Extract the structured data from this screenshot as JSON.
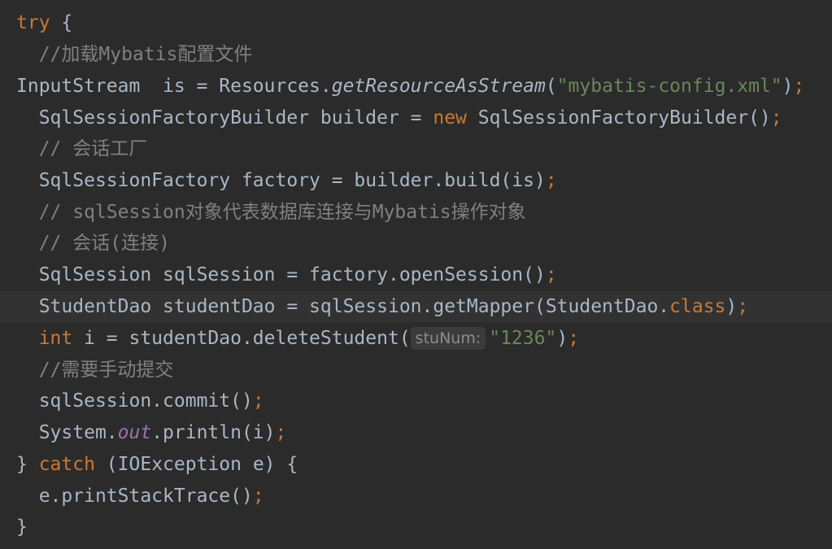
{
  "editor": {
    "lines": [
      {
        "indent": "",
        "tokens": [
          {
            "t": "try",
            "c": "kw"
          },
          {
            "t": " {",
            "c": ""
          }
        ]
      },
      {
        "indent": "  ",
        "tokens": [
          {
            "t": "//加载Mybatis配置文件",
            "c": "cmt"
          }
        ]
      },
      {
        "indent": "",
        "tokens": [
          {
            "t": "InputStream  is = Resources.",
            "c": ""
          },
          {
            "t": "getResourceAsStream",
            "c": "italic"
          },
          {
            "t": "(",
            "c": ""
          },
          {
            "t": "\"mybatis-config.xml\"",
            "c": "str"
          },
          {
            "t": ")",
            "c": ""
          },
          {
            "t": ";",
            "c": "punc"
          }
        ]
      },
      {
        "indent": "  ",
        "tokens": [
          {
            "t": "SqlSessionFactoryBuilder builder = ",
            "c": ""
          },
          {
            "t": "new",
            "c": "kw"
          },
          {
            "t": " SqlSessionFactoryBuilder()",
            "c": ""
          },
          {
            "t": ";",
            "c": "punc"
          }
        ]
      },
      {
        "indent": "  ",
        "tokens": [
          {
            "t": "// 会话工厂",
            "c": "cmt"
          }
        ]
      },
      {
        "indent": "  ",
        "tokens": [
          {
            "t": "SqlSessionFactory factory = builder.build(is)",
            "c": ""
          },
          {
            "t": ";",
            "c": "punc"
          }
        ]
      },
      {
        "indent": "  ",
        "tokens": [
          {
            "t": "// sqlSession对象代表数据库连接与Mybatis操作对象",
            "c": "cmt"
          }
        ]
      },
      {
        "indent": "  ",
        "tokens": [
          {
            "t": "// 会话(连接)",
            "c": "cmt"
          }
        ]
      },
      {
        "indent": "  ",
        "tokens": [
          {
            "t": "SqlSession sqlSession = factory.openSession()",
            "c": ""
          },
          {
            "t": ";",
            "c": "punc"
          }
        ]
      },
      {
        "indent": "  ",
        "current": true,
        "tokens": [
          {
            "t": "StudentDao studentDao = sqlSession.getMapper(StudentDao.",
            "c": ""
          },
          {
            "t": "class",
            "c": "kw"
          },
          {
            "t": ")",
            "c": ""
          },
          {
            "t": ";",
            "c": "punc"
          }
        ]
      },
      {
        "indent": "  ",
        "tokens": [
          {
            "t": "int",
            "c": "kw"
          },
          {
            "t": " i = studentDao.deleteStudent(",
            "c": ""
          },
          {
            "t": "stuNum:",
            "c": "hint"
          },
          {
            "t": "\"1236\"",
            "c": "str"
          },
          {
            "t": ")",
            "c": ""
          },
          {
            "t": ";",
            "c": "punc"
          }
        ]
      },
      {
        "indent": "  ",
        "tokens": [
          {
            "t": "//需要手动提交",
            "c": "cmt"
          }
        ]
      },
      {
        "indent": "  ",
        "tokens": [
          {
            "t": "sqlSession.commit()",
            "c": ""
          },
          {
            "t": ";",
            "c": "punc"
          }
        ]
      },
      {
        "indent": "  ",
        "tokens": [
          {
            "t": "System.",
            "c": ""
          },
          {
            "t": "out",
            "c": "static"
          },
          {
            "t": ".println(i)",
            "c": ""
          },
          {
            "t": ";",
            "c": "punc"
          }
        ]
      },
      {
        "indent": "",
        "tokens": [
          {
            "t": "} ",
            "c": ""
          },
          {
            "t": "catch",
            "c": "kw"
          },
          {
            "t": " (IOException e) {",
            "c": ""
          }
        ]
      },
      {
        "indent": "  ",
        "tokens": [
          {
            "t": "e.printStackTrace()",
            "c": ""
          },
          {
            "t": ";",
            "c": "punc"
          }
        ]
      },
      {
        "indent": "",
        "tokens": [
          {
            "t": "}",
            "c": ""
          }
        ]
      }
    ]
  },
  "colors": {
    "background": "#2b2b2b",
    "current_line": "#323232",
    "default_text": "#a9b7c6",
    "keyword": "#cc7832",
    "string": "#6a8759",
    "comment": "#808080",
    "static_field": "#9876aa",
    "inlay_hint_bg": "#3b3b3b",
    "inlay_hint_text": "#8c8c8c"
  }
}
